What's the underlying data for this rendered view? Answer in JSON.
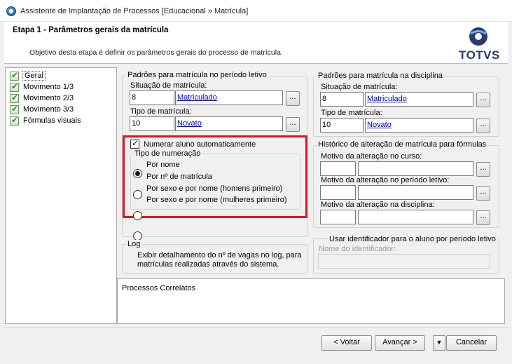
{
  "window": {
    "title": "Assistente de Implantação de Processos [Educacional » Matrícula]"
  },
  "header": {
    "step_title": "Etapa 1 - Parâmetros gerais da matrícula",
    "description": "Objetivo desta etapa é definir os parâmetros gerais do processo de matrícula",
    "logo_text": "TOTVS"
  },
  "tree": {
    "items": [
      {
        "label": "Geral",
        "selected": true
      },
      {
        "label": "Movimento 1/3"
      },
      {
        "label": "Movimento 2/3"
      },
      {
        "label": "Movimento 3/3"
      },
      {
        "label": "Fórmulas visuais"
      }
    ]
  },
  "periodo": {
    "title": "Padrões para matrícula no período letivo",
    "situacao_label": "Situação de matrícula:",
    "situacao_code": "8",
    "situacao_link": "Matriculado",
    "tipo_label": "Tipo de matrícula:",
    "tipo_code": "10",
    "tipo_link": "Novato",
    "button": "..."
  },
  "disciplina": {
    "title": "Padrões para matrícula na disciplina",
    "situacao_label": "Situação de matrícula:",
    "situacao_code": "8",
    "situacao_link": "Matriculado",
    "tipo_label": "Tipo de matrícula:",
    "tipo_code": "10",
    "tipo_link": "Novato",
    "button": "..."
  },
  "numeracao": {
    "checkbox_label": "Numerar aluno automaticamente",
    "group_title": "Tipo de numeração",
    "options": [
      {
        "label": "Por nome",
        "checked": true
      },
      {
        "label": "Por nº de matrícula"
      },
      {
        "label": "Por sexo e por nome (homens primeiro)"
      },
      {
        "label": "Por sexo e por nome (mulheres primeiro)"
      }
    ]
  },
  "historico": {
    "title": "Histórico de alteração de matrícula para fórmulas",
    "curso_label": "Motivo da alteração no curso:",
    "periodo_label": "Motivo da alteração no período letivo:",
    "disciplina_label": "Motivo da alteração na disciplina:",
    "button": "..."
  },
  "log": {
    "title": "Log",
    "checkbox_label_line1": "Exibir detalhamento do nº de vagas no log, para",
    "checkbox_label_line2": "matrículas realizadas através do sistema."
  },
  "identificador": {
    "checkbox_label": "Usar identificador para o aluno por período letivo",
    "name_label": "Nome do identificador:"
  },
  "related": {
    "title": "Processos Correlatos"
  },
  "footer": {
    "back": "< Voltar",
    "next": "Avançar >",
    "cancel": "Cancelar"
  }
}
